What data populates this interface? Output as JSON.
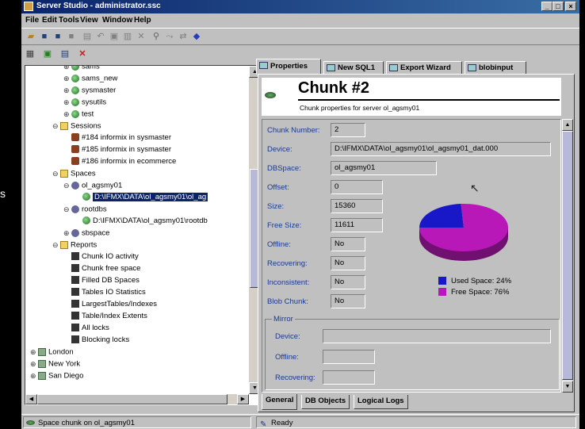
{
  "window": {
    "title": "Server Studio  - administrator.ssc",
    "left_fragment": "s"
  },
  "menu": [
    "File",
    "Edit",
    "Tools",
    "View",
    "Window",
    "Help"
  ],
  "toolbar_icons": [
    "open-icon",
    "save-icon",
    "save-all-icon",
    "cut-icon",
    "print-icon",
    "undo-icon",
    "copy-icon",
    "paste-icon",
    "delete-icon",
    "find-icon",
    "find-next-icon",
    "replace-icon",
    "run-icon"
  ],
  "tree": [
    {
      "indent": 3,
      "icon": "db",
      "label": "sams",
      "toggle": "+"
    },
    {
      "indent": 3,
      "icon": "db",
      "label": "sams_new",
      "toggle": "+"
    },
    {
      "indent": 3,
      "icon": "db",
      "label": "sysmaster",
      "toggle": "+"
    },
    {
      "indent": 3,
      "icon": "db",
      "label": "sysutils",
      "toggle": "+"
    },
    {
      "indent": 3,
      "icon": "db",
      "label": "test",
      "toggle": "+"
    },
    {
      "indent": 2,
      "icon": "folder",
      "label": "Sessions",
      "toggle": "-"
    },
    {
      "indent": 3,
      "icon": "user",
      "label": "#184 informix in sysmaster",
      "toggle": ""
    },
    {
      "indent": 3,
      "icon": "user",
      "label": "#185 informix in sysmaster",
      "toggle": ""
    },
    {
      "indent": 3,
      "icon": "user",
      "label": "#186 informix in ecommerce",
      "toggle": ""
    },
    {
      "indent": 2,
      "icon": "folder",
      "label": "Spaces",
      "toggle": "-"
    },
    {
      "indent": 3,
      "icon": "disk",
      "label": "ol_agsmy01",
      "toggle": "-"
    },
    {
      "indent": 4,
      "icon": "db",
      "label": "D:\\IFMX\\DATA\\ol_agsmy01\\ol_ag",
      "toggle": "",
      "selected": true
    },
    {
      "indent": 3,
      "icon": "disk",
      "label": "rootdbs",
      "toggle": "-"
    },
    {
      "indent": 4,
      "icon": "db",
      "label": "D:\\IFMX\\DATA\\ol_agsmy01\\rootdb",
      "toggle": ""
    },
    {
      "indent": 3,
      "icon": "disk",
      "label": "sbspace",
      "toggle": "+"
    },
    {
      "indent": 2,
      "icon": "folder",
      "label": "Reports",
      "toggle": "-"
    },
    {
      "indent": 3,
      "icon": "rep",
      "label": "Chunk IO activity",
      "toggle": ""
    },
    {
      "indent": 3,
      "icon": "rep",
      "label": "Chunk free space",
      "toggle": ""
    },
    {
      "indent": 3,
      "icon": "rep",
      "label": "Filled DB Spaces",
      "toggle": ""
    },
    {
      "indent": 3,
      "icon": "rep",
      "label": "Tables IO Statistics",
      "toggle": ""
    },
    {
      "indent": 3,
      "icon": "rep",
      "label": "LargestTables/Indexes",
      "toggle": ""
    },
    {
      "indent": 3,
      "icon": "rep",
      "label": "Table/Index Extents",
      "toggle": ""
    },
    {
      "indent": 3,
      "icon": "rep",
      "label": "All locks",
      "toggle": ""
    },
    {
      "indent": 3,
      "icon": "rep",
      "label": "Blocking locks",
      "toggle": ""
    },
    {
      "indent": 0,
      "icon": "srv",
      "label": "London",
      "toggle": "+"
    },
    {
      "indent": 0,
      "icon": "srv",
      "label": "New York",
      "toggle": "+"
    },
    {
      "indent": 0,
      "icon": "srv",
      "label": "San Diego",
      "toggle": "+"
    }
  ],
  "tabs": [
    "Properties",
    "New SQL1",
    "Export Wizard",
    "blobinput"
  ],
  "header": {
    "title": "Chunk #2",
    "subtitle": "Chunk properties for server ol_agsmy01"
  },
  "fields": {
    "chunk_number": {
      "label": "Chunk Number:",
      "value": "2"
    },
    "device": {
      "label": "Device:",
      "value": "D:\\IFMX\\DATA\\ol_agsmy01\\ol_agsmy01_dat.000"
    },
    "dbspace": {
      "label": "DBSpace:",
      "value": "ol_agsmy01"
    },
    "offset": {
      "label": "Offset:",
      "value": "0"
    },
    "size": {
      "label": "Size:",
      "value": "15360"
    },
    "free_size": {
      "label": "Free Size:",
      "value": "11611"
    },
    "offline": {
      "label": "Offline:",
      "value": "No"
    },
    "recovering": {
      "label": "Recovering:",
      "value": "No"
    },
    "inconsistent": {
      "label": "Inconsistent:",
      "value": "No"
    },
    "blob_chunk": {
      "label": "Blob Chunk:",
      "value": "No"
    }
  },
  "mirror": {
    "title": "Mirror",
    "device_label": "Device:",
    "offline_label": "Offline:",
    "recovering_label": "Recovering:"
  },
  "pie": {
    "used_label": "Used Space: 24%",
    "free_label": "Free Space: 76%",
    "used_fraction": 0.24,
    "used_color": "#1818c8",
    "free_color": "#b818b8"
  },
  "bottom_tabs": [
    "General",
    "DB Objects",
    "Logical Logs"
  ],
  "status": {
    "left": "Space chunk on ol_agsmy01",
    "right": "Ready"
  }
}
